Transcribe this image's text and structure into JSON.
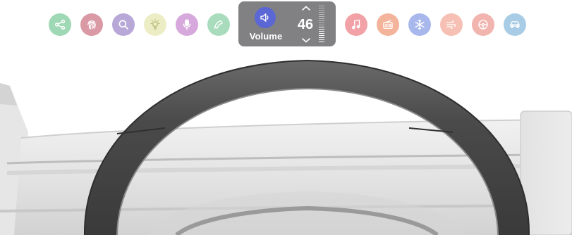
{
  "toolbar": {
    "icons": [
      {
        "name": "share-icon",
        "color": "#9fd8b4"
      },
      {
        "name": "fingerprint-icon",
        "color": "#d99aa6"
      },
      {
        "name": "search-icon",
        "color": "#b8a8d8"
      },
      {
        "name": "lightbulb-icon",
        "color": "#ecedc4"
      },
      {
        "name": "microphone-icon",
        "color": "#d6a8dc"
      },
      {
        "name": "phone-icon",
        "color": "#a8dcbc"
      },
      {
        "name": "music-icon",
        "color": "#f2a2a6"
      },
      {
        "name": "radio-icon",
        "color": "#f4b49c"
      },
      {
        "name": "snowflake-icon",
        "color": "#a8b8ec"
      },
      {
        "name": "fan-icon",
        "color": "#f6c0b4"
      },
      {
        "name": "steering-icon",
        "color": "#f2b4ae"
      },
      {
        "name": "car-icon",
        "color": "#a8cce6"
      }
    ]
  },
  "volume": {
    "label": "Volume",
    "value": "46",
    "level": 0.46,
    "accent": "#5a67d4",
    "icon": "speaker-icon"
  }
}
